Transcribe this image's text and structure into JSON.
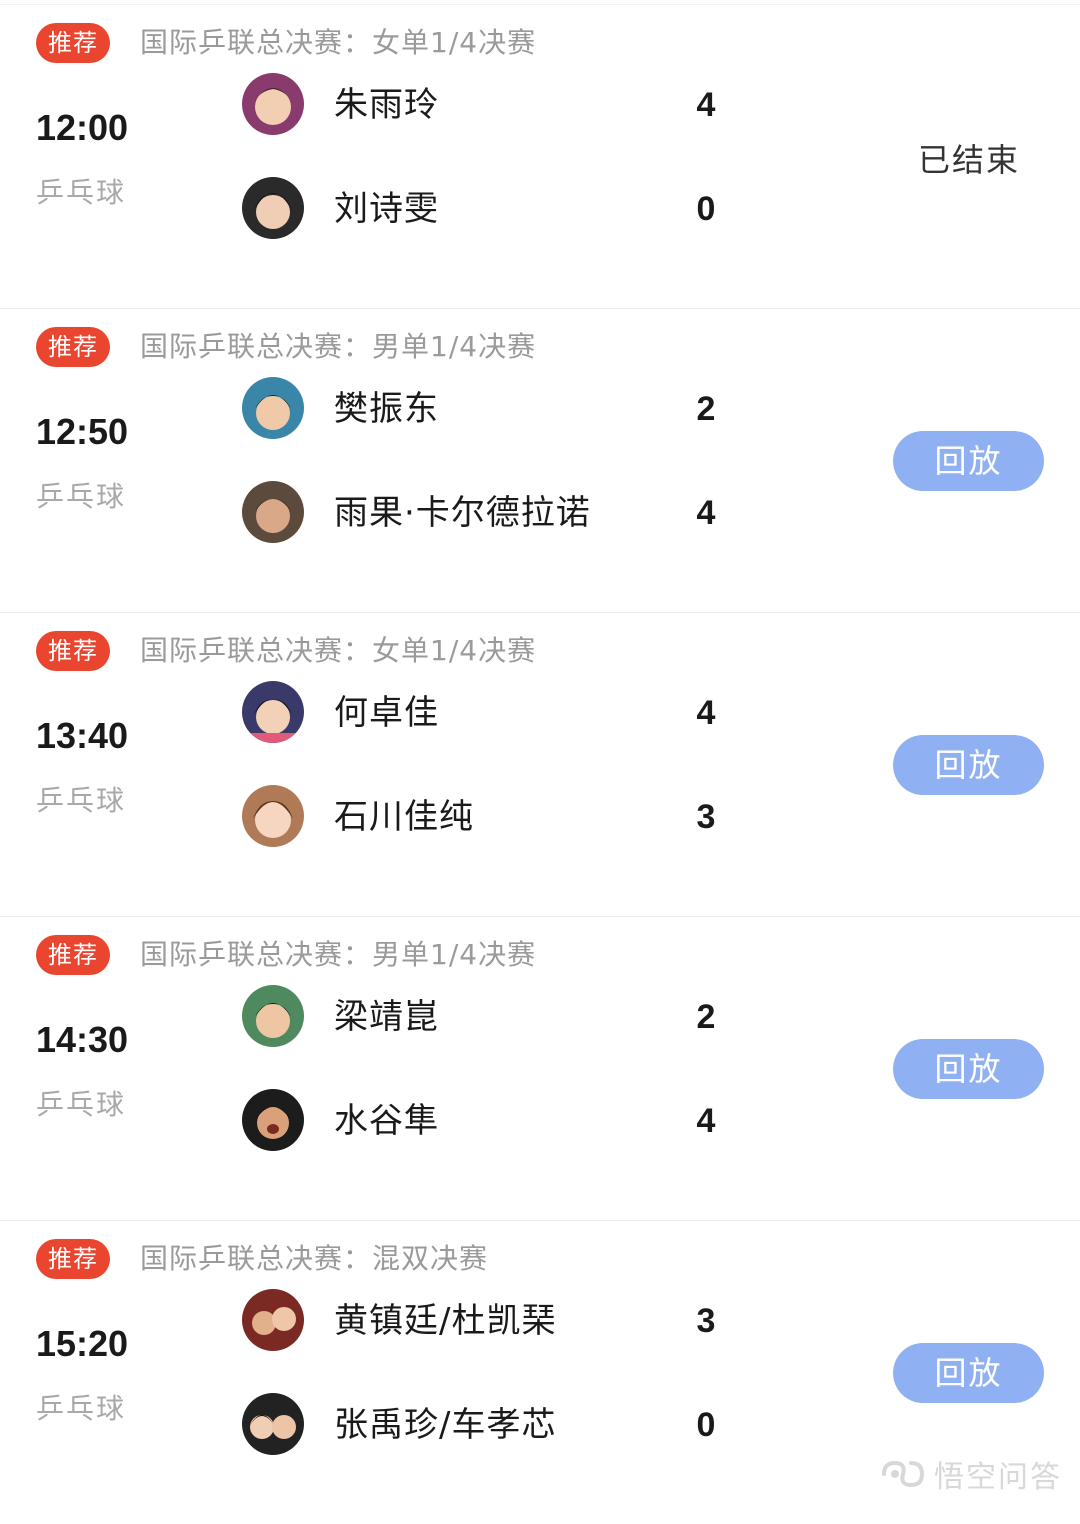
{
  "matches": [
    {
      "badge": "推荐",
      "event": "国际乒联总决赛：女单1/4决赛",
      "time": "12:00",
      "sport": "乒乓球",
      "players": [
        {
          "name": "朱雨玲",
          "score": "4",
          "avatar_color": "#8a3b6e"
        },
        {
          "name": "刘诗雯",
          "score": "0",
          "avatar_color": "#2a2a2a"
        }
      ],
      "status": "已结束",
      "action": ""
    },
    {
      "badge": "推荐",
      "event": "国际乒联总决赛：男单1/4决赛",
      "time": "12:50",
      "sport": "乒乓球",
      "players": [
        {
          "name": "樊振东",
          "score": "2",
          "avatar_color": "#3a86a8"
        },
        {
          "name": "雨果·卡尔德拉诺",
          "score": "4",
          "avatar_color": "#5c4a3c"
        }
      ],
      "status": "",
      "action": "回放"
    },
    {
      "badge": "推荐",
      "event": "国际乒联总决赛：女单1/4决赛",
      "time": "13:40",
      "sport": "乒乓球",
      "players": [
        {
          "name": "何卓佳",
          "score": "4",
          "avatar_color": "#3a3a6a"
        },
        {
          "name": "石川佳纯",
          "score": "3",
          "avatar_color": "#b07a56"
        }
      ],
      "status": "",
      "action": "回放"
    },
    {
      "badge": "推荐",
      "event": "国际乒联总决赛：男单1/4决赛",
      "time": "14:30",
      "sport": "乒乓球",
      "players": [
        {
          "name": "梁靖崑",
          "score": "2",
          "avatar_color": "#4f8a5e"
        },
        {
          "name": "水谷隼",
          "score": "4",
          "avatar_color": "#1c1c1c"
        }
      ],
      "status": "",
      "action": "回放"
    },
    {
      "badge": "推荐",
      "event": "国际乒联总决赛：混双决赛",
      "time": "15:20",
      "sport": "乒乓球",
      "players": [
        {
          "name": "黄镇廷/杜凯琹",
          "score": "3",
          "avatar_color": "#7a2a22"
        },
        {
          "name": "张禹珍/车孝芯",
          "score": "0",
          "avatar_color": "#222222"
        }
      ],
      "status": "",
      "action": "回放"
    }
  ],
  "watermark": {
    "text": "悟空问答",
    "icon": "wukong-logo-icon"
  },
  "colors": {
    "badge": "#e9452f",
    "replay_button": "#8fb1f3",
    "muted_text": "#9a9a9a"
  }
}
